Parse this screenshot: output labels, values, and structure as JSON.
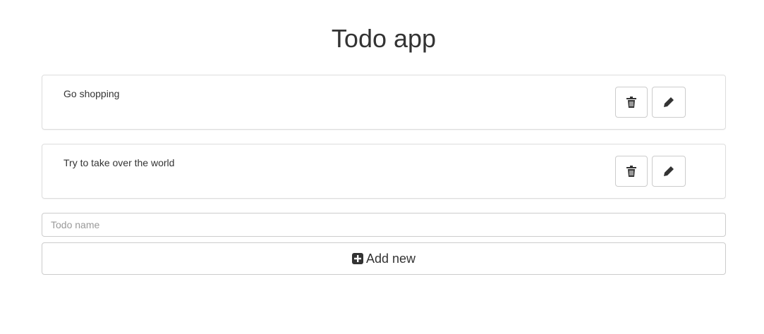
{
  "title": "Todo app",
  "todos": [
    {
      "name": "Go shopping"
    },
    {
      "name": "Try to take over the world"
    }
  ],
  "input": {
    "placeholder": "Todo name",
    "value": ""
  },
  "add_label": "Add new"
}
